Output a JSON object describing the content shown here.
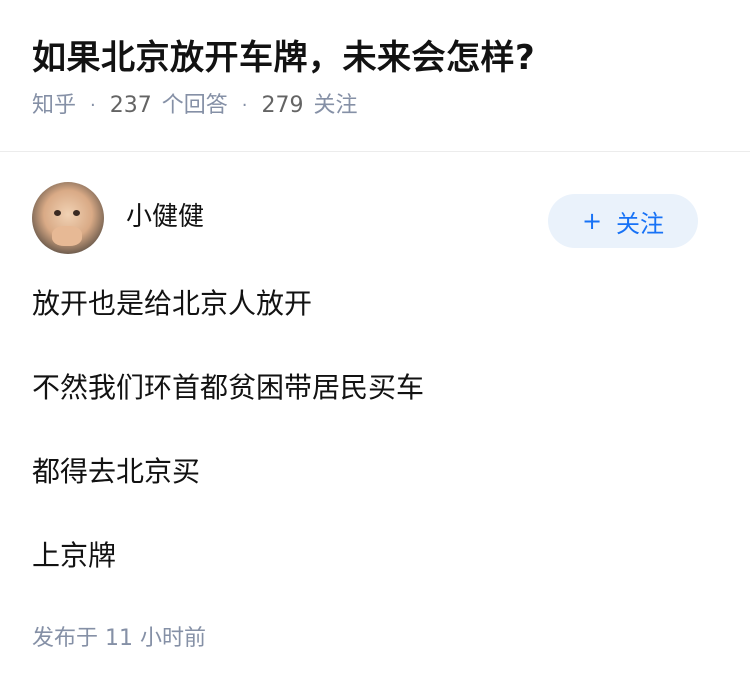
{
  "question": {
    "title": "如果北京放开车牌，未来会怎样?",
    "source": "知乎",
    "answer_count": "237",
    "answer_label": "个回答",
    "follow_count": "279",
    "follow_label": "关注"
  },
  "answer": {
    "author_name": "小健健",
    "follow_button_label": "关注",
    "follow_button_icon": "plus-icon",
    "paragraphs": [
      "放开也是给北京人放开",
      "不然我们环首都贫困带居民买车",
      "都得去北京买",
      "上京牌"
    ],
    "post_time": "发布于  11 小时前"
  },
  "colors": {
    "accent": "#1772f6",
    "accent_bg": "#eaf2fb",
    "meta_gray": "#8590a6",
    "text": "#121212"
  }
}
